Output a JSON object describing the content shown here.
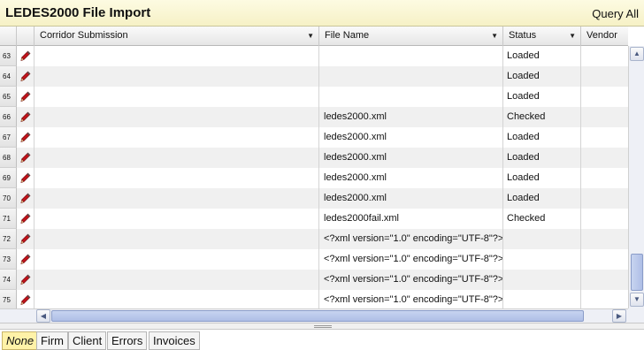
{
  "window": {
    "title": "LEDES2000 File Import",
    "query_all": "Query All"
  },
  "columns": [
    {
      "label": "Corridor Submission",
      "has_menu": true
    },
    {
      "label": "File Name",
      "has_menu": true
    },
    {
      "label": "Status",
      "has_menu": true
    },
    {
      "label": "Vendor",
      "has_menu": false
    }
  ],
  "rows": [
    {
      "num": "63",
      "corridor": "",
      "file": "",
      "status": "Loaded",
      "vendor": ""
    },
    {
      "num": "64",
      "corridor": "",
      "file": "",
      "status": "Loaded",
      "vendor": ""
    },
    {
      "num": "65",
      "corridor": "",
      "file": "",
      "status": "Loaded",
      "vendor": ""
    },
    {
      "num": "66",
      "corridor": "",
      "file": "ledes2000.xml",
      "status": "Checked",
      "vendor": ""
    },
    {
      "num": "67",
      "corridor": "",
      "file": "ledes2000.xml",
      "status": "Loaded",
      "vendor": ""
    },
    {
      "num": "68",
      "corridor": "",
      "file": "ledes2000.xml",
      "status": "Loaded",
      "vendor": ""
    },
    {
      "num": "69",
      "corridor": "",
      "file": "ledes2000.xml",
      "status": "Loaded",
      "vendor": ""
    },
    {
      "num": "70",
      "corridor": "",
      "file": "ledes2000.xml",
      "status": "Loaded",
      "vendor": ""
    },
    {
      "num": "71",
      "corridor": "",
      "file": "ledes2000fail.xml",
      "status": "Checked",
      "vendor": ""
    },
    {
      "num": "72",
      "corridor": "",
      "file": "<?xml version=\"1.0\" encoding=\"UTF-8\"?> <",
      "status": "",
      "vendor": ""
    },
    {
      "num": "73",
      "corridor": "",
      "file": "<?xml version=\"1.0\" encoding=\"UTF-8\"?> <",
      "status": "",
      "vendor": ""
    },
    {
      "num": "74",
      "corridor": "",
      "file": "<?xml version=\"1.0\" encoding=\"UTF-8\"?> <",
      "status": "",
      "vendor": ""
    },
    {
      "num": "75",
      "corridor": "",
      "file": "<?xml version=\"1.0\" encoding=\"UTF-8\"?> <",
      "status": "",
      "vendor": ""
    }
  ],
  "row_icon": "edit-pencil-icon",
  "tabs": [
    {
      "label": "None",
      "active": true
    },
    {
      "label": "Firm",
      "active": false
    },
    {
      "label": "Client",
      "active": false
    },
    {
      "label": "Errors",
      "active": false
    },
    {
      "label": "Invoices",
      "active": false
    }
  ],
  "colors": {
    "title_bg": "#fdfbe2",
    "active_tab": "#fff2a8",
    "pencil": "#c0141b"
  }
}
